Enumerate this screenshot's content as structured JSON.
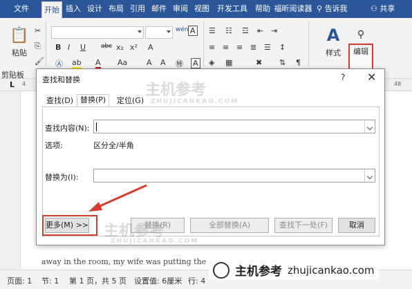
{
  "ribbon_tabs": [
    "文件",
    "开始",
    "插入",
    "设计",
    "布局",
    "引用",
    "邮件",
    "审阅",
    "视图",
    "开发工具",
    "帮助",
    "福昕阅读器"
  ],
  "tell_me": "告诉我",
  "share": "共享",
  "ribbon": {
    "paste_label": "粘贴",
    "clipboard_label": "剪贴板",
    "style_label": "样式",
    "edit_label": "编辑"
  },
  "ruler": {
    "left": "4",
    "right": "48"
  },
  "document_text": "away in the room, my wife was putting the",
  "status": [
    "页面: 1",
    "节: 1",
    "第 1 页，共 5 页",
    "设置值: 6厘米",
    "行: 4"
  ],
  "dialog": {
    "title": "查找和替换",
    "help": "?",
    "close": "✕",
    "tabs": [
      "查找(D)",
      "替换(P)",
      "定位(G)"
    ],
    "find_label": "查找内容(N):",
    "find_value": "",
    "options_label": "选项:",
    "options_value": "区分全/半角",
    "replace_label": "替换为(I):",
    "replace_value": "",
    "buttons": {
      "more": "更多(M) >>",
      "replace": "替换(R)",
      "replace_all": "全部替换(A)",
      "find_next": "查找下一处(F)",
      "cancel": "取消"
    }
  },
  "watermark": {
    "text": "主机参考",
    "url": "ZHUJICANKAO.COM",
    "bottom_text": "主机参考",
    "bottom_url": "zhujicankao.com"
  },
  "colors": {
    "accent": "#2b579a",
    "highlight": "#d83a2b"
  }
}
